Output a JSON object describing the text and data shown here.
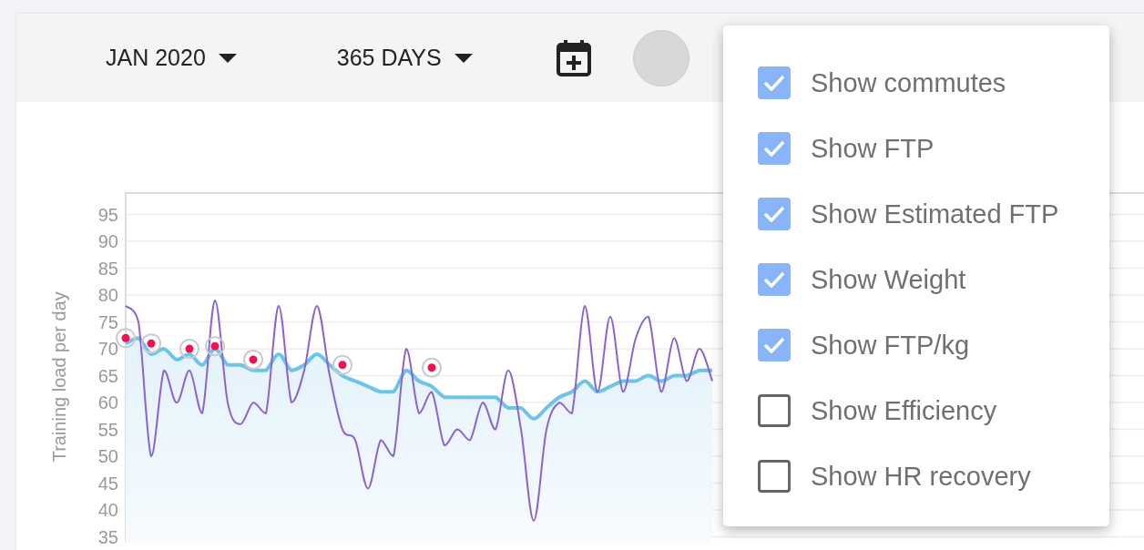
{
  "toolbar": {
    "month": "JAN 2020",
    "range": "365 DAYS"
  },
  "chart": {
    "chart_data": {
      "type": "line",
      "grid": true,
      "ylabel": "Training load per day",
      "ylim": [
        34,
        99
      ],
      "yticks": [
        35,
        40,
        45,
        50,
        55,
        60,
        65,
        70,
        75,
        80,
        85,
        90,
        95
      ],
      "series": [
        {
          "type": "line",
          "color": "#8a63d2",
          "values": [
            78,
            75,
            50,
            66,
            60,
            66,
            58,
            79,
            60,
            56,
            60,
            58,
            78,
            60,
            66,
            78,
            65,
            55,
            53,
            44,
            53,
            50,
            70,
            58,
            62,
            52,
            55,
            53,
            60,
            55,
            66,
            55,
            38,
            55,
            60,
            58,
            78,
            62,
            76,
            62,
            72,
            76,
            62,
            72,
            64,
            70,
            64
          ]
        },
        {
          "type": "area",
          "color": "#6ec3e8",
          "values": [
            71,
            72,
            69,
            70,
            68,
            69,
            67,
            70,
            67,
            67,
            66,
            66,
            69,
            66,
            67,
            69,
            67,
            65,
            64,
            63,
            62,
            62,
            66,
            64,
            63,
            61,
            61,
            61,
            61,
            61,
            59,
            59,
            57,
            59,
            61,
            62,
            64,
            62,
            63,
            64,
            64,
            65,
            64,
            65,
            65,
            66,
            66
          ]
        },
        {
          "type": "scatter",
          "color": "#f0134d",
          "values": [
            72,
            null,
            71,
            null,
            null,
            70,
            null,
            70.5,
            null,
            null,
            68,
            null,
            null,
            null,
            null,
            null,
            null,
            67,
            null,
            null,
            null,
            null,
            null,
            null,
            66.5,
            null,
            null,
            null,
            null,
            null,
            null,
            null,
            null,
            null,
            null,
            null,
            null,
            null,
            null,
            null,
            null,
            null,
            null,
            null,
            null,
            null,
            null
          ]
        }
      ]
    }
  },
  "menu": {
    "items": [
      {
        "label": "Show commutes",
        "checked": true
      },
      {
        "label": "Show FTP",
        "checked": true
      },
      {
        "label": "Show Estimated FTP",
        "checked": true
      },
      {
        "label": "Show Weight",
        "checked": true
      },
      {
        "label": "Show FTP/kg",
        "checked": true
      },
      {
        "label": "Show Efficiency",
        "checked": false
      },
      {
        "label": "Show HR recovery",
        "checked": false
      }
    ]
  }
}
